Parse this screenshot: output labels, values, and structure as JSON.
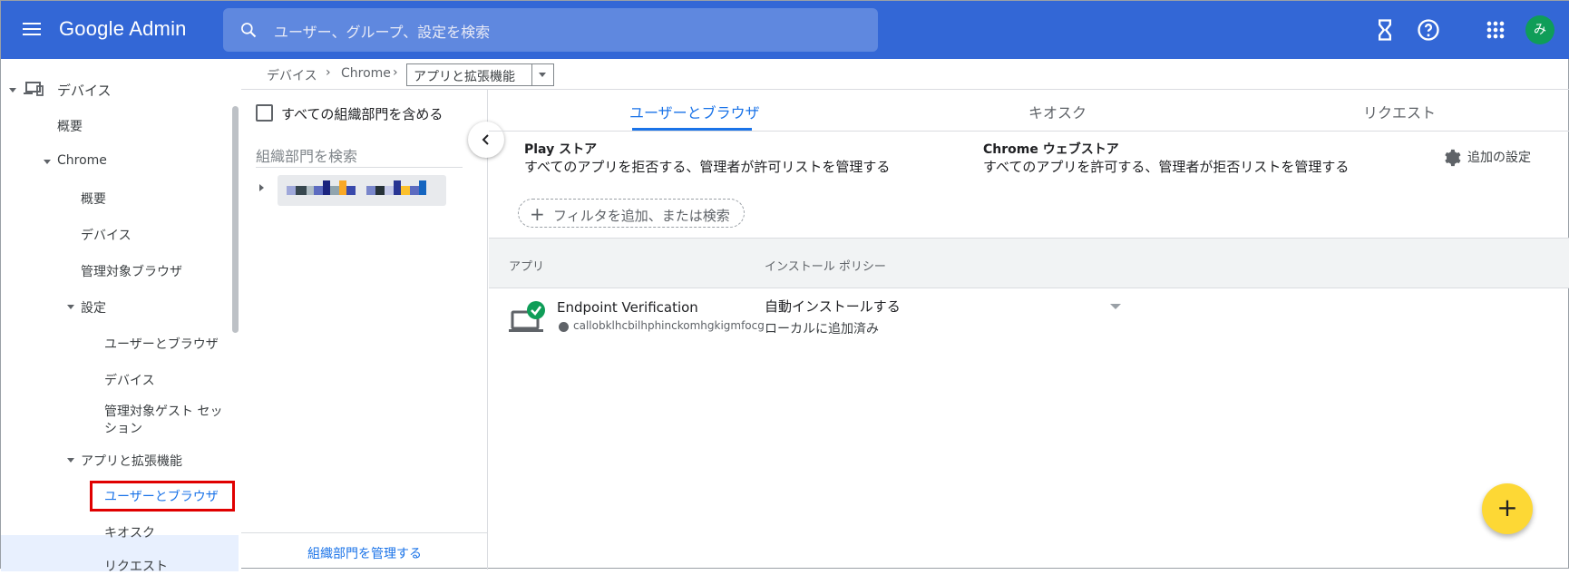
{
  "topbar": {
    "app_title": "Google Admin",
    "search_placeholder": "ユーザー、グループ、設定を検索",
    "avatar_letter": "み",
    "brand_color": "#3367d6",
    "icons": [
      "menu-icon",
      "search-icon",
      "hourglass-icon",
      "help-icon",
      "apps-grid-icon"
    ]
  },
  "sidebar": {
    "devices": "デバイス",
    "overview": "概要",
    "chrome": "Chrome",
    "chrome_overview": "概要",
    "chrome_devices": "デバイス",
    "managed_browsers": "管理対象ブラウザ",
    "settings": "設定",
    "settings_users_browsers": "ユーザーとブラウザ",
    "settings_devices": "デバイス",
    "managed_guest_line1": "管理対象ゲスト セッ",
    "managed_guest_line2": "ション",
    "apps_extensions": "アプリと拡張機能",
    "apps_users_browsers": "ユーザーとブラウザ",
    "apps_kiosk": "キオスク",
    "apps_requests": "リクエスト"
  },
  "breadcrumb": {
    "items": [
      "デバイス",
      "Chrome"
    ],
    "separator": "›",
    "current": "アプリと拡張機能"
  },
  "org_panel": {
    "include_all_label": "すべての組織部門を含める",
    "search_placeholder": "組織部門を検索",
    "manage_link": "組織部門を管理する"
  },
  "tabs": [
    {
      "label": "ユーザーとブラウザ",
      "active": true
    },
    {
      "label": "キオスク",
      "active": false
    },
    {
      "label": "リクエスト",
      "active": false
    }
  ],
  "stores": {
    "play_title": "Play ストア",
    "play_desc": "すべてのアプリを拒否する、管理者が許可リストを管理する",
    "chrome_title": "Chrome ウェブストア",
    "chrome_desc": "すべてのアプリを許可する、管理者が拒否リストを管理する",
    "more_settings": "追加の設定"
  },
  "filter": {
    "label": "フィルタを追加、または検索"
  },
  "table": {
    "headers": [
      "アプリ",
      "インストール ポリシー"
    ],
    "rows": [
      {
        "name": "Endpoint Verification",
        "id": "callobklhcbilhphinckomhgkigmfocg",
        "policy": "自動インストールする",
        "policy_sub": "ローカルに追加済み"
      }
    ]
  },
  "fab": {
    "label": "+",
    "color": "#fdd835"
  }
}
